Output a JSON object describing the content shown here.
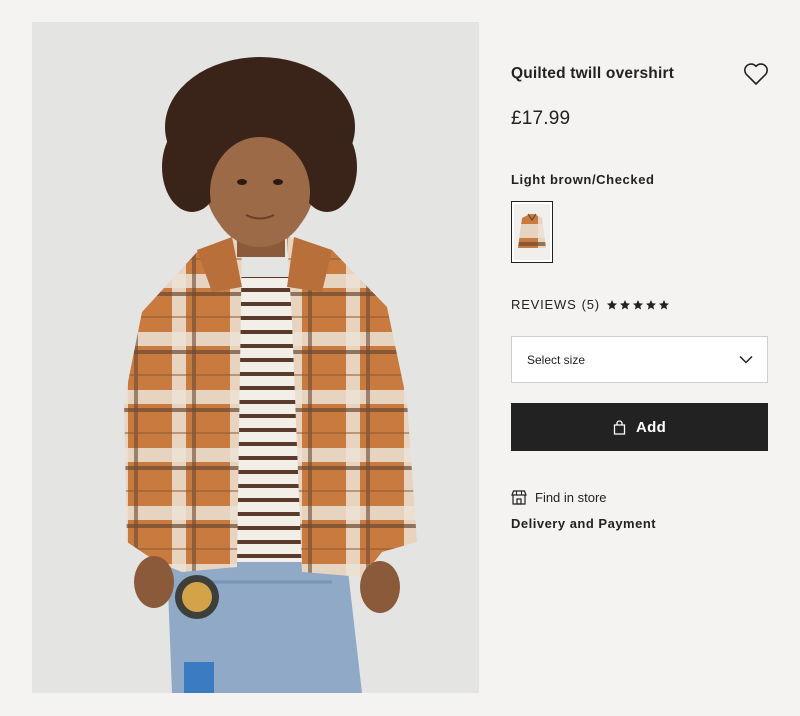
{
  "product": {
    "title": "Quilted twill overshirt",
    "price": "£17.99",
    "color_name": "Light brown/Checked",
    "image_alt": "Child wearing a light brown checked quilted twill overshirt"
  },
  "reviews": {
    "label": "REVIEWS",
    "count": "(5)",
    "rating": 5
  },
  "size_select": {
    "selected": "Select size"
  },
  "add_button": {
    "label": "Add"
  },
  "links": {
    "find_in_store": "Find in store",
    "delivery_payment": "Delivery and Payment"
  },
  "icons": {
    "favorite": "heart-outline-icon",
    "chevron": "chevron-down-icon",
    "bag": "shopping-bag-icon",
    "store": "store-icon",
    "star": "star-icon"
  },
  "colors": {
    "primary": "#222222",
    "background": "#f4f3f1",
    "image_background": "#e4e4e3",
    "border": "#cfcfcf"
  }
}
